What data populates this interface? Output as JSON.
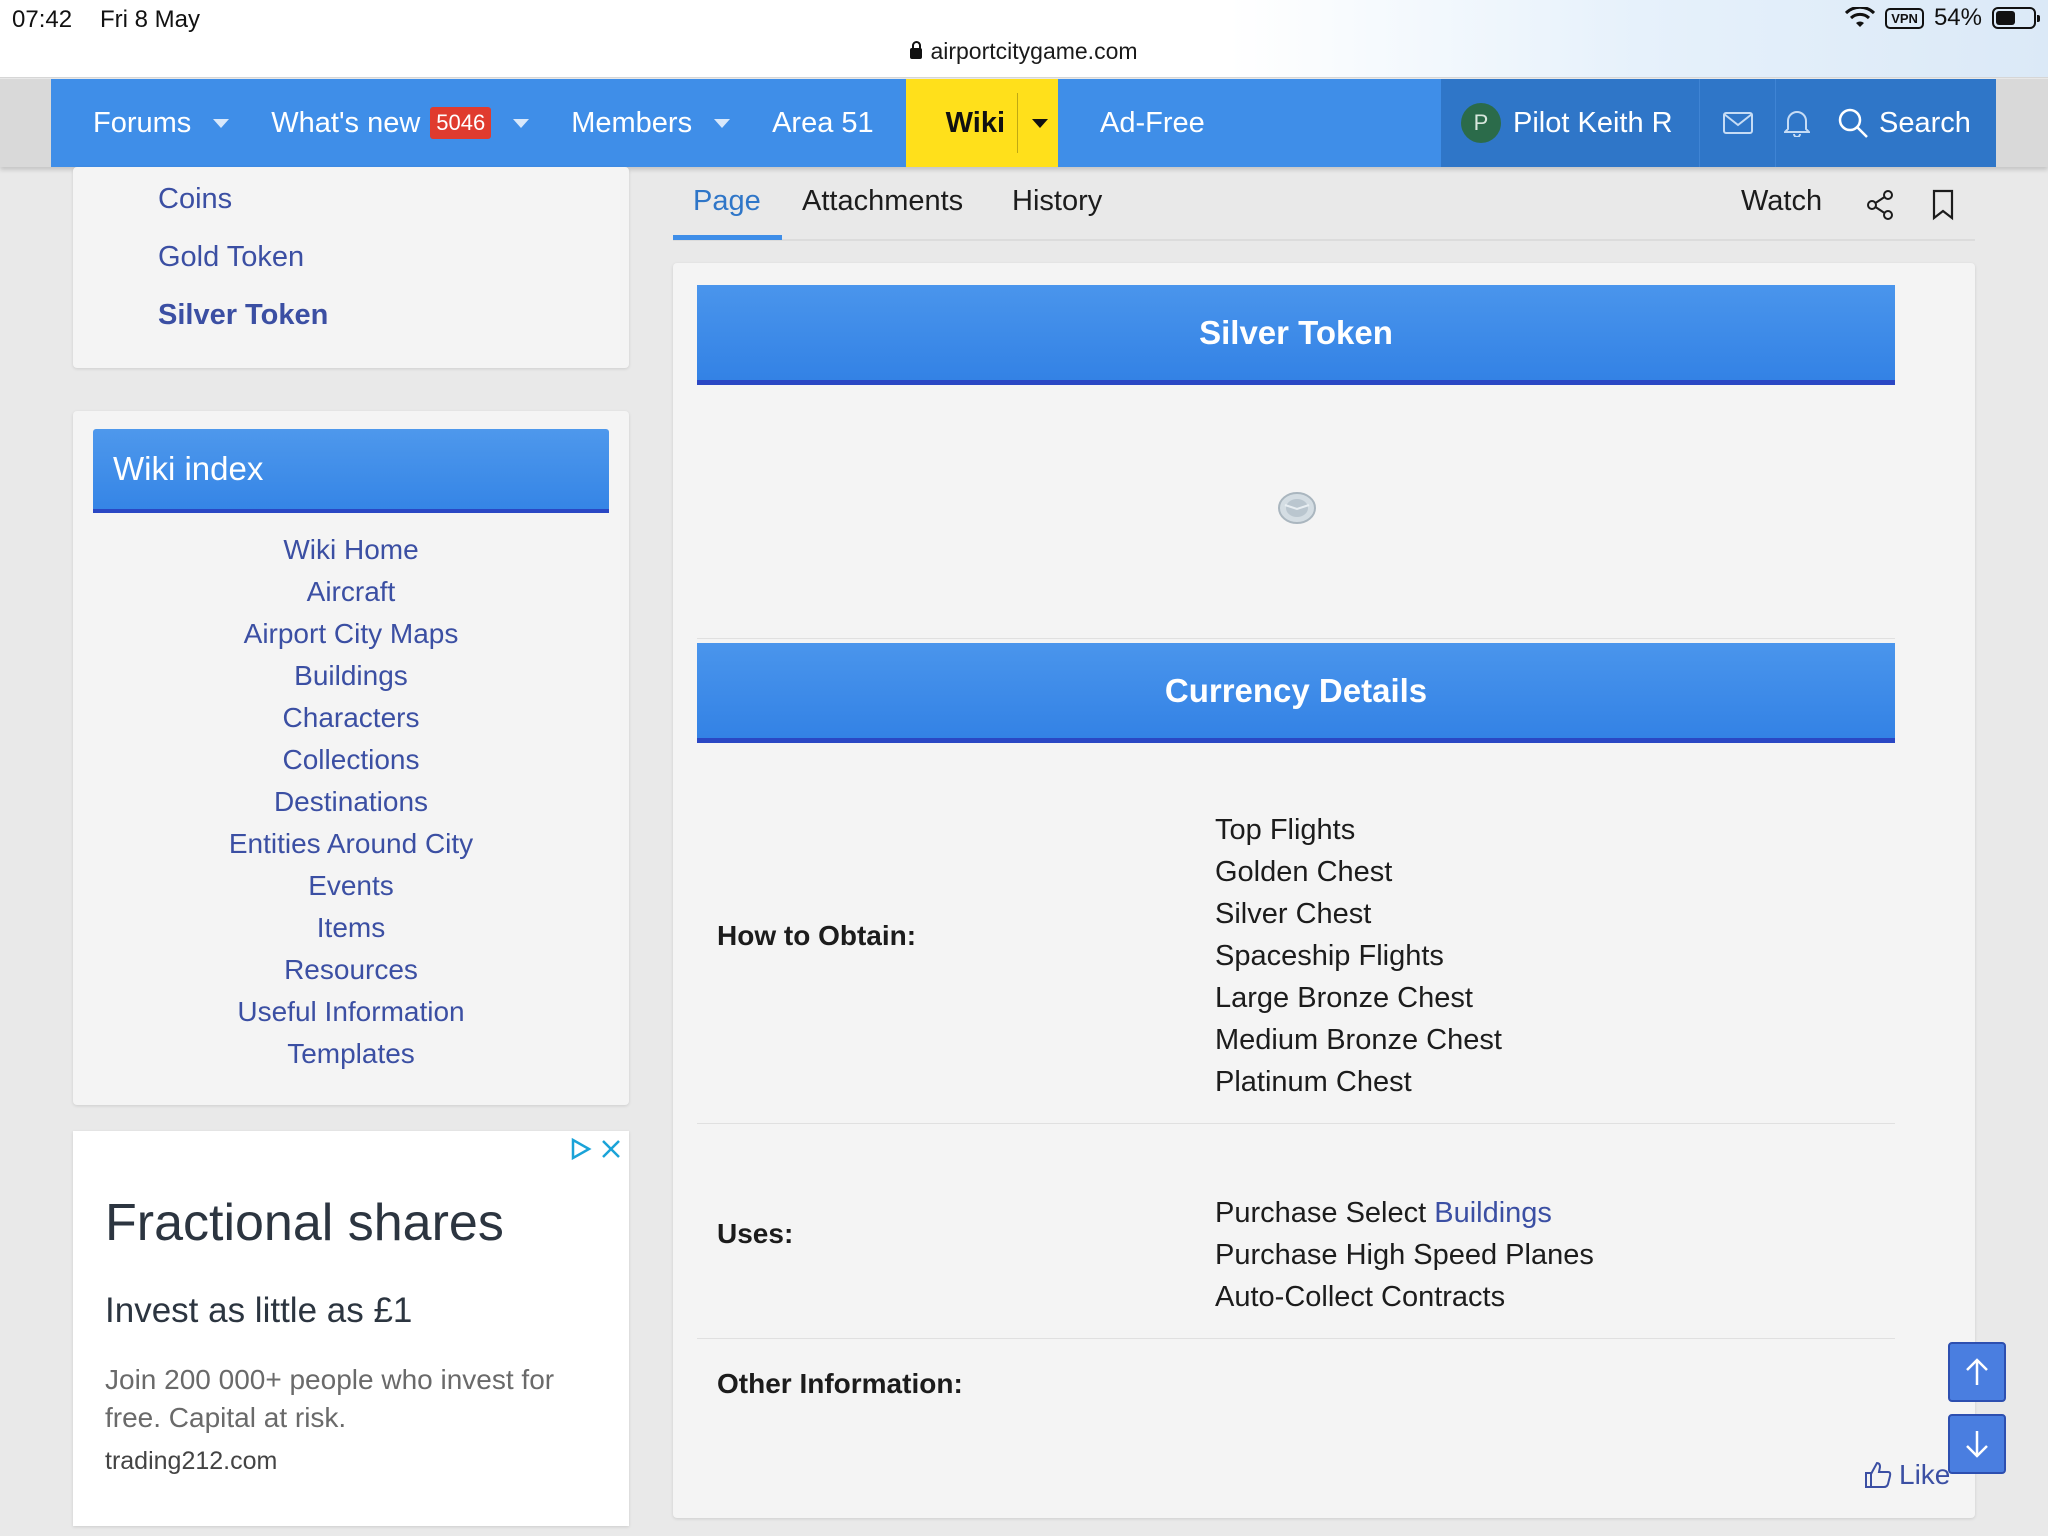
{
  "status": {
    "time": "07:42",
    "date": "Fri 8 May",
    "vpn": "VPN",
    "battery": "54%",
    "battery_level": 0.54,
    "url": "airportcitygame.com"
  },
  "nav": {
    "forums": "Forums",
    "whats_new": "What's new",
    "whats_new_badge": "5046",
    "members": "Members",
    "area51": "Area 51",
    "wiki": "Wiki",
    "adfree": "Ad-Free",
    "user_initial": "P",
    "user_name": "Pilot Keith R",
    "search": "Search"
  },
  "sidebar": {
    "top_items": [
      "Coins",
      "Gold Token",
      "Silver Token"
    ],
    "wiki_index_title": "Wiki index",
    "wiki_index": [
      "Wiki Home",
      "Aircraft",
      "Airport City Maps",
      "Buildings",
      "Characters",
      "Collections",
      "Destinations",
      "Entities Around City",
      "Events",
      "Items",
      "Resources",
      "Useful Information",
      "Templates"
    ]
  },
  "ad": {
    "title": "Fractional shares",
    "subtitle": "Invest as little as £1",
    "body": "Join 200 000+ people who invest for free. Capital at risk.",
    "url": "trading212.com"
  },
  "tabs": {
    "page": "Page",
    "attachments": "Attachments",
    "history": "History",
    "watch": "Watch"
  },
  "article": {
    "title": "Silver Token",
    "section": "Currency Details",
    "obtain_label": "How to Obtain:",
    "obtain": [
      "Top Flights",
      "Golden Chest",
      "Silver Chest",
      "Spaceship Flights",
      "Large Bronze Chest",
      "Medium Bronze Chest",
      "Platinum Chest"
    ],
    "uses_label": "Uses:",
    "uses_prefix": "Purchase Select ",
    "uses_link": "Buildings",
    "uses_rest": [
      "Purchase High Speed Planes",
      "Auto-Collect Contracts"
    ],
    "other_label": "Other Information:",
    "like": "Like"
  },
  "colors": {
    "nav_blue": "#3f8ee8",
    "nav_dark": "#2f76c8",
    "wiki_yellow": "#ffe01b",
    "link": "#3b4fa3",
    "badge_red": "#e03b2e"
  }
}
